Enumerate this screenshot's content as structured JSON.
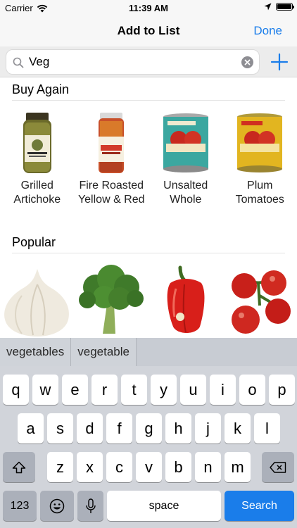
{
  "status_bar": {
    "carrier": "Carrier",
    "time": "11:39 AM"
  },
  "nav": {
    "title": "Add to List",
    "done_label": "Done"
  },
  "search": {
    "value": "Veg"
  },
  "sections": {
    "buy_again": {
      "title": "Buy Again",
      "items": [
        {
          "line1": "Grilled",
          "line2": "Artichoke"
        },
        {
          "line1": "Fire Roasted",
          "line2": "Yellow & Red"
        },
        {
          "line1": "Unsalted",
          "line2": "Whole"
        },
        {
          "line1": "Plum",
          "line2": "Tomatoes"
        }
      ]
    },
    "popular": {
      "title": "Popular"
    }
  },
  "suggestions": [
    "vegetables",
    "vegetable"
  ],
  "keyboard": {
    "row1": [
      "q",
      "w",
      "e",
      "r",
      "t",
      "y",
      "u",
      "i",
      "o",
      "p"
    ],
    "row2": [
      "a",
      "s",
      "d",
      "f",
      "g",
      "h",
      "j",
      "k",
      "l"
    ],
    "row3": [
      "z",
      "x",
      "c",
      "v",
      "b",
      "n",
      "m"
    ],
    "numbers_label": "123",
    "space_label": "space",
    "search_label": "Search"
  },
  "colors": {
    "accent": "#1a7dea",
    "keyboard_bg": "#d1d4da"
  }
}
